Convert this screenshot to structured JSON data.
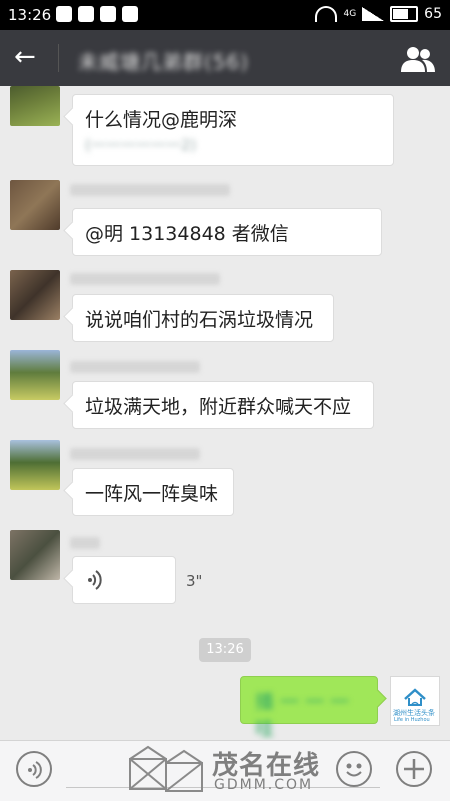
{
  "status_bar": {
    "time": "13:26",
    "network": "4G",
    "battery": "65"
  },
  "header": {
    "back_icon": "arrow-left-icon",
    "title": "未威塘几弟群(56)",
    "members_icon": "group-icon"
  },
  "messages": [
    {
      "type": "text",
      "from": "other",
      "text": "什么情况@鹿明深",
      "second_line": "(一一一一一一2)"
    },
    {
      "type": "text",
      "from": "other",
      "text": "@明 13134848 者微信"
    },
    {
      "type": "text",
      "from": "other",
      "text": "说说咱们村的石涡垃圾情况"
    },
    {
      "type": "text",
      "from": "other",
      "text": "垃圾满天地，附近群众喊天不应"
    },
    {
      "type": "text",
      "from": "other",
      "text": "一阵风一阵臭味"
    },
    {
      "type": "voice",
      "from": "other",
      "duration": "3\""
    },
    {
      "type": "time",
      "text": "13:26"
    },
    {
      "type": "text",
      "from": "me",
      "text": "播 一 一 一 哇"
    }
  ],
  "my_avatar": {
    "label": "湖州生活头条",
    "sub": "Life in Huzhou"
  },
  "watermark": {
    "text": "茂名在线",
    "sub": "GDMM.COM"
  },
  "input_bar": {
    "voice_icon": "voice-icon",
    "emoji_icon": "emoji-icon",
    "plus_icon": "plus-icon"
  }
}
